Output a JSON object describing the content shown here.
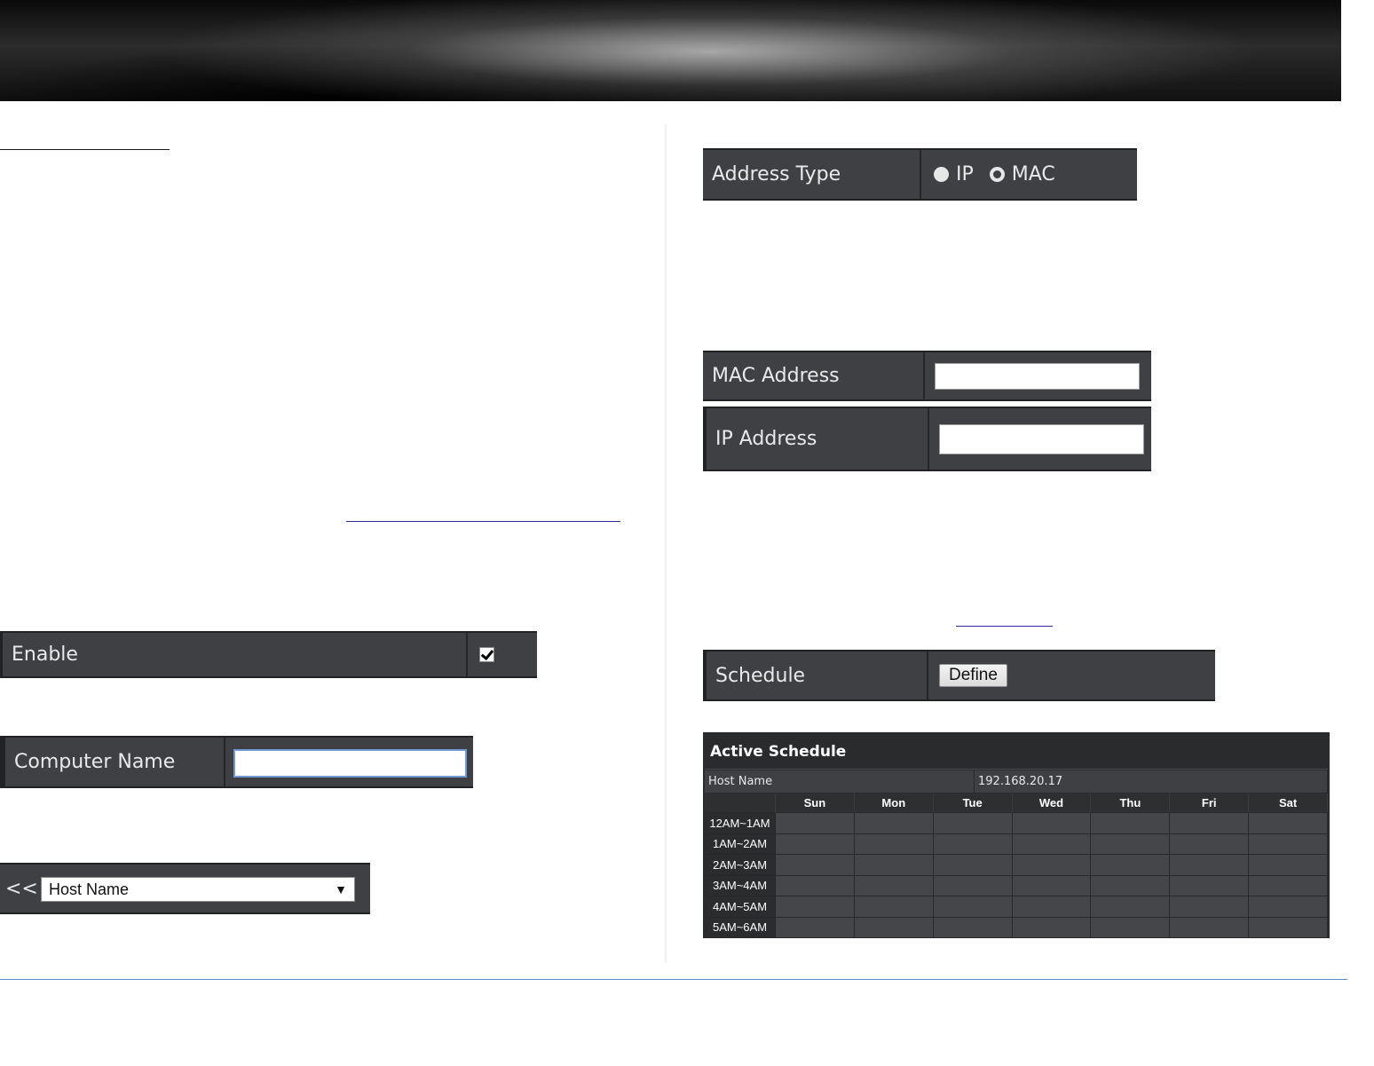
{
  "address_type": {
    "label": "Address Type",
    "options": [
      "IP",
      "MAC"
    ],
    "selected": "MAC"
  },
  "mac_address": {
    "label": "MAC Address",
    "value": ""
  },
  "ip_address": {
    "label": "IP Address",
    "value": ""
  },
  "schedule": {
    "label": "Schedule",
    "button": "Define"
  },
  "enable": {
    "label": "Enable",
    "checked": true
  },
  "computer_name": {
    "label": "Computer Name",
    "value": ""
  },
  "host_select": {
    "prefix": "<<",
    "selected": "Host Name"
  },
  "active_schedule": {
    "title": "Active Schedule",
    "host_label": "Host Name",
    "host_value": "192.168.20.17",
    "days": [
      "Sun",
      "Mon",
      "Tue",
      "Wed",
      "Thu",
      "Fri",
      "Sat"
    ],
    "times": [
      "12AM~1AM",
      "1AM~2AM",
      "2AM~3AM",
      "3AM~4AM",
      "4AM~5AM",
      "5AM~6AM"
    ]
  }
}
